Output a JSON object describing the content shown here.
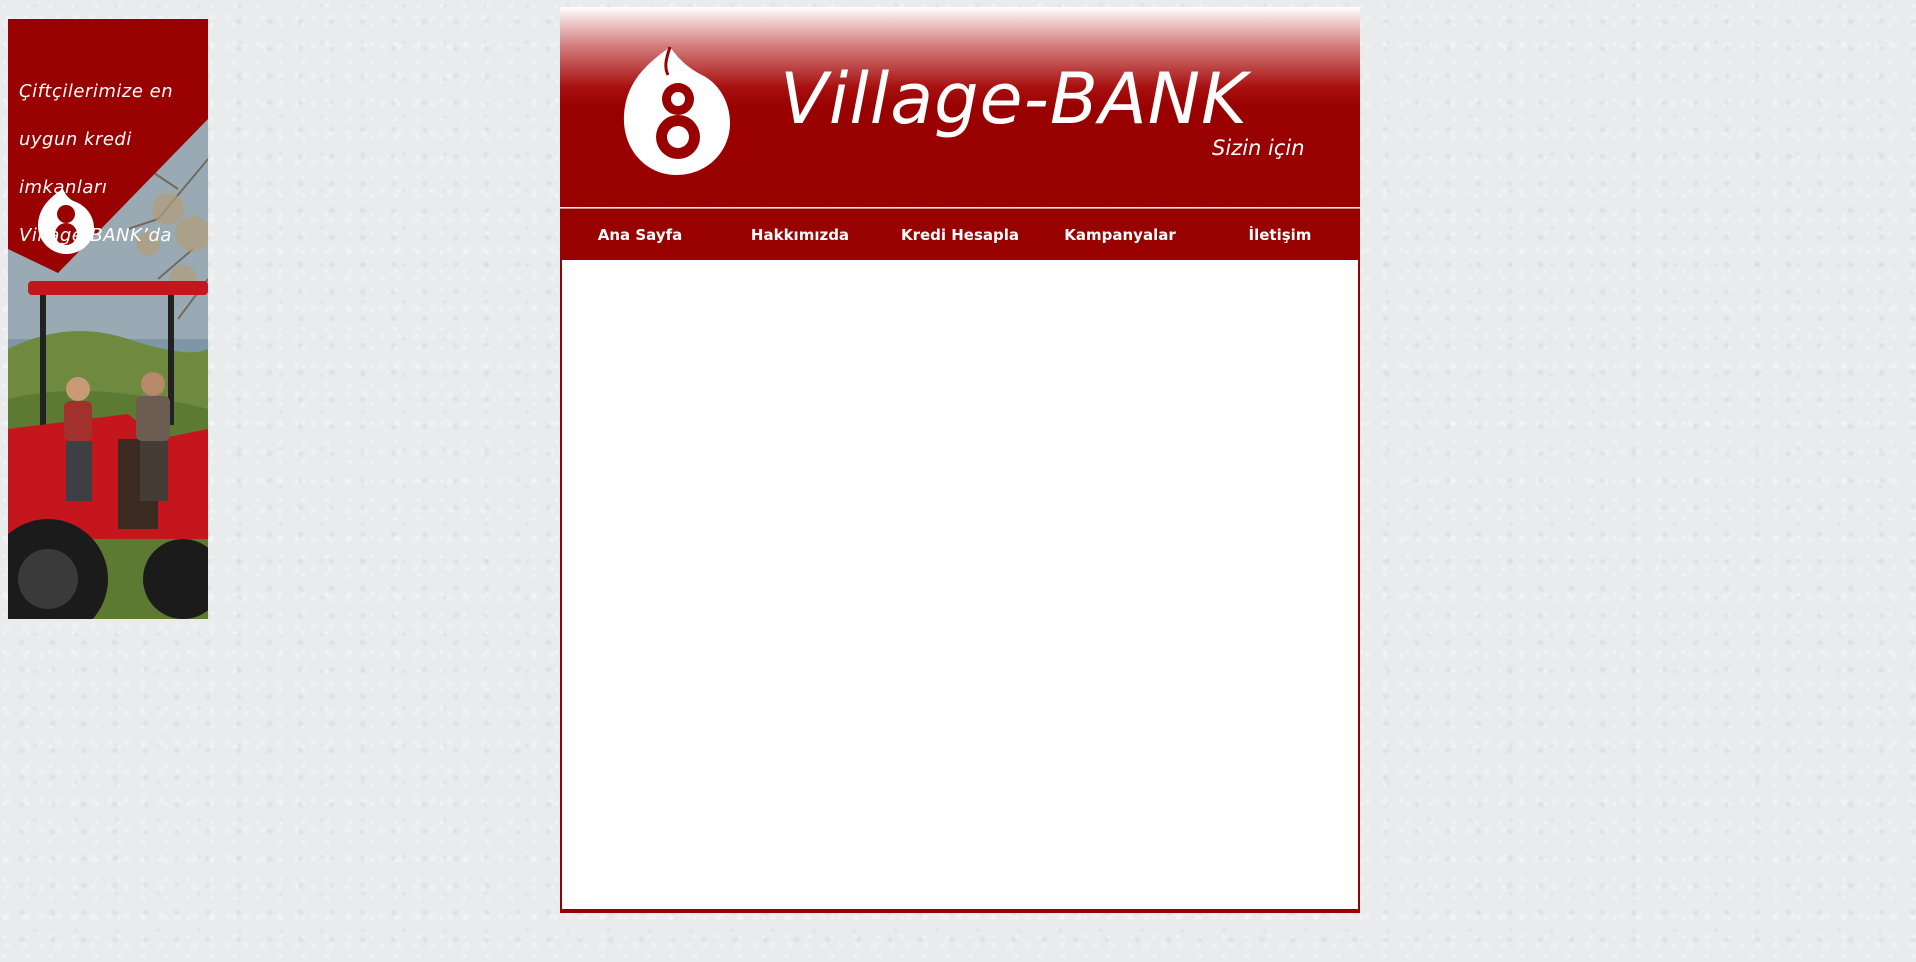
{
  "ad_banner": {
    "headline_lines": [
      "Çiftçilerimize en",
      "uygun kredi",
      "imkanları",
      "Village-BANK’da"
    ],
    "logo_icon": "village-bank-logo-icon",
    "photo": "tractor-farmer-photo"
  },
  "header": {
    "logo_icon": "village-bank-logo-icon",
    "brand_title": "Village-BANK",
    "tagline": "Sizin için"
  },
  "nav": {
    "items": [
      {
        "label": "Ana Sayfa"
      },
      {
        "label": "Hakkımızda"
      },
      {
        "label": "Kredi Hesapla"
      },
      {
        "label": "Kampanyalar"
      },
      {
        "label": "İletişim"
      }
    ]
  },
  "colors": {
    "brand_red": "#990000",
    "page_background": "#e9ebec",
    "content_background": "#ffffff",
    "text_on_red": "#ffffff"
  }
}
